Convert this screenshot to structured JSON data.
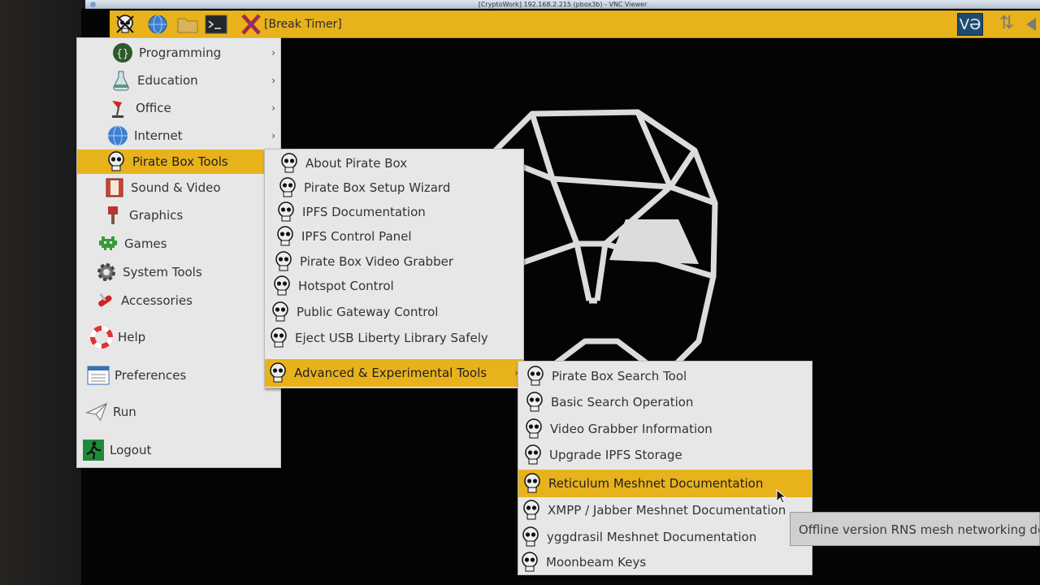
{
  "vnc": {
    "title": "[CryptoWork] 192.168.2.215 (pbox3b) - VNC Viewer"
  },
  "taskbar": {
    "task_label": "[Break Timer]",
    "tray_label": "VƏ",
    "sync_glyph": "⇅"
  },
  "main_menu": {
    "items": [
      {
        "label": "Programming",
        "icon": "programming-icon"
      },
      {
        "label": "Education",
        "icon": "flask-icon"
      },
      {
        "label": "Office",
        "icon": "office-lamp-icon"
      },
      {
        "label": "Internet",
        "icon": "globe-icon"
      },
      {
        "label": "Pirate Box Tools",
        "icon": "skull-icon"
      },
      {
        "label": "Sound & Video",
        "icon": "film-icon"
      },
      {
        "label": "Graphics",
        "icon": "paintbrush-icon"
      },
      {
        "label": "Games",
        "icon": "alien-invader-icon"
      },
      {
        "label": "System Tools",
        "icon": "gear-icon"
      },
      {
        "label": "Accessories",
        "icon": "pocket-knife-icon"
      },
      {
        "label": "Help",
        "icon": "lifebuoy-icon"
      },
      {
        "label": "Preferences",
        "icon": "preferences-icon"
      },
      {
        "label": "Run",
        "icon": "paper-plane-icon"
      },
      {
        "label": "Logout",
        "icon": "exit-icon"
      }
    ]
  },
  "pirate_box_menu": {
    "items": [
      {
        "label": "About Pirate Box"
      },
      {
        "label": "Pirate Box Setup Wizard"
      },
      {
        "label": "IPFS Documentation"
      },
      {
        "label": "IPFS Control Panel"
      },
      {
        "label": "Pirate Box Video Grabber"
      },
      {
        "label": "Hotspot Control"
      },
      {
        "label": "Public Gateway Control"
      },
      {
        "label": "Eject USB Liberty Library Safely"
      },
      {
        "label": "Advanced & Experimental Tools"
      }
    ]
  },
  "advanced_menu": {
    "items": [
      {
        "label": "Pirate Box Search Tool"
      },
      {
        "label": "Basic Search Operation"
      },
      {
        "label": "Video Grabber Information"
      },
      {
        "label": "Upgrade IPFS Storage"
      },
      {
        "label": "Reticulum Meshnet Documentation"
      },
      {
        "label": "XMPP / Jabber Meshnet Documentation"
      },
      {
        "label": "yggdrasil Meshnet Documentation"
      },
      {
        "label": "Moonbeam Keys"
      }
    ]
  },
  "tooltip": {
    "text": "Offline version RNS mesh networking do"
  },
  "colors": {
    "highlight": "#e8b21c",
    "menu_bg": "#e7e7e7",
    "desktop": "#040404"
  }
}
